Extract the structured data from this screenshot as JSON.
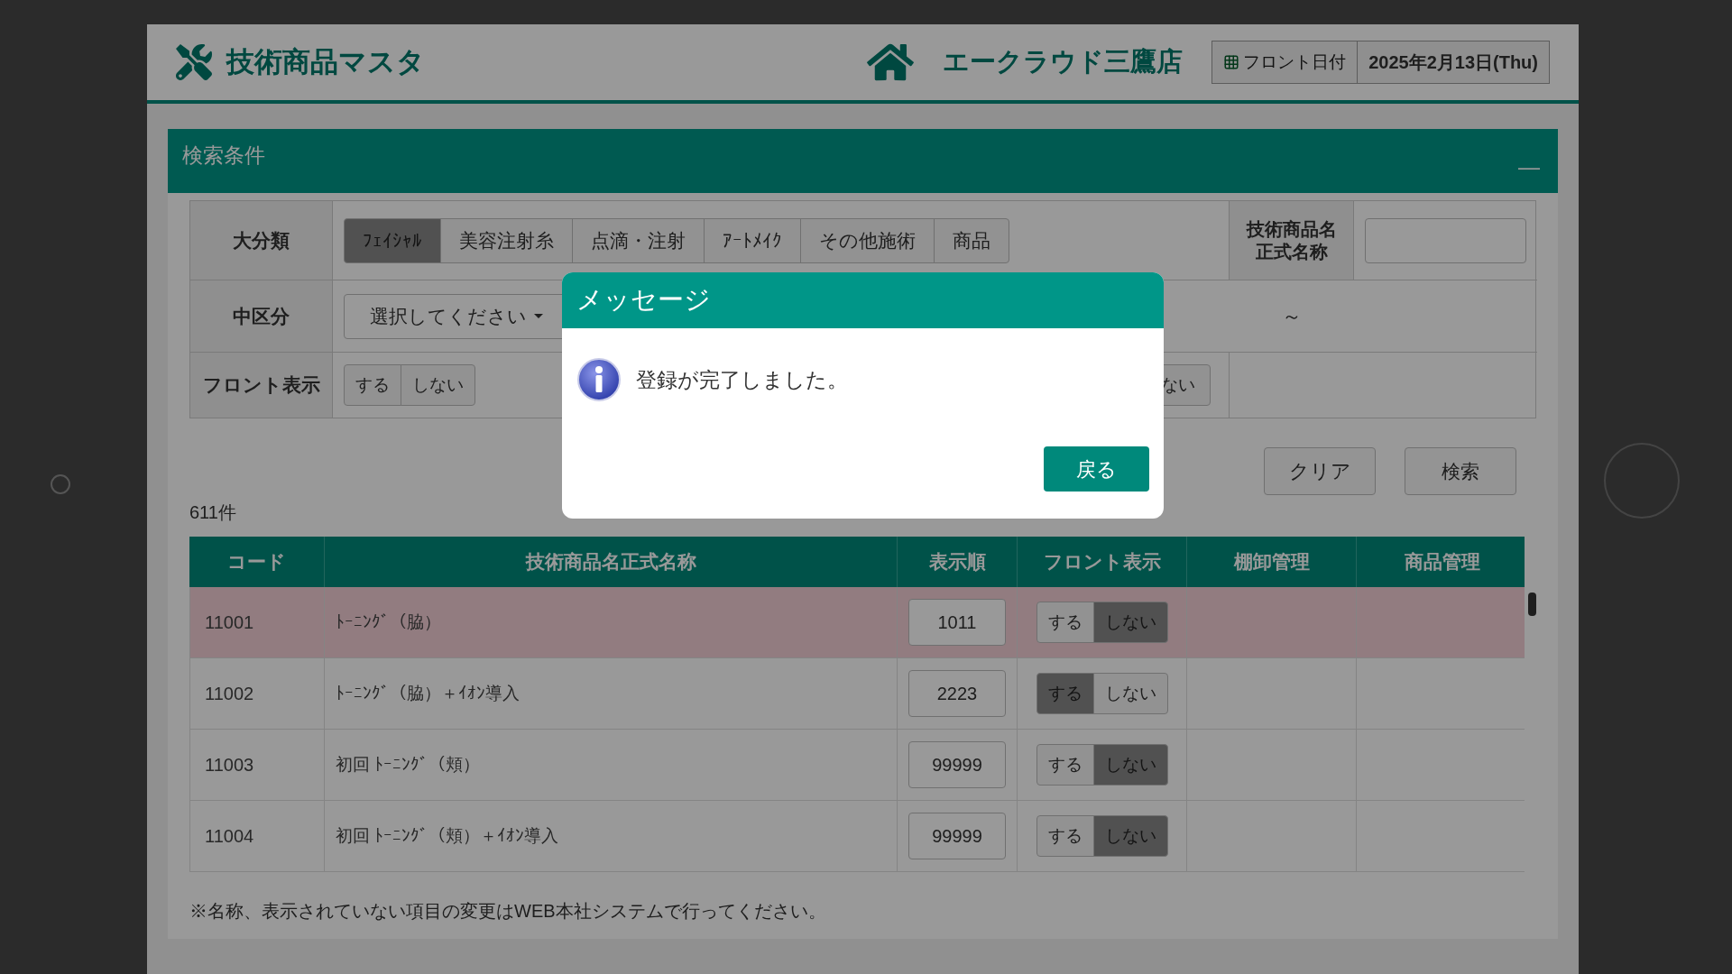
{
  "header": {
    "title": "技術商品マスタ",
    "store": "エークラウド三鷹店",
    "date_label": "フロント日付",
    "date": "2025年2月13日(Thu)"
  },
  "search_panel": {
    "title": "検索条件",
    "collapse": "—",
    "category": {
      "label": "大分類",
      "options": [
        {
          "label": "ﾌｪｲｼｬﾙ",
          "selected": true
        },
        {
          "label": "美容注射糸",
          "selected": false
        },
        {
          "label": "点滴・注射",
          "selected": false
        },
        {
          "label": "ｱｰﾄﾒｲｸ",
          "selected": false
        },
        {
          "label": "その他施術",
          "selected": false
        },
        {
          "label": "商品",
          "selected": false
        }
      ]
    },
    "name_label": [
      "技術商品名",
      "正式名称"
    ],
    "subcategory": {
      "label": "中区分",
      "value": "選択してください"
    },
    "range_separator": "～",
    "front": {
      "label": "フロント表示",
      "options": [
        {
          "label": "する",
          "selected": false
        },
        {
          "label": "しない",
          "selected": false
        }
      ]
    },
    "partial_option": "ない",
    "buttons": [
      "クリア",
      "検索"
    ]
  },
  "count": "611件",
  "table": {
    "columns": [
      "コード",
      "技術商品名正式名称",
      "表示順",
      "フロント表示",
      "棚卸管理",
      "商品管理"
    ],
    "rows": [
      {
        "code": "11001",
        "name": "ﾄｰﾆﾝｸﾞ（脇）",
        "order": "1011",
        "selected": true,
        "front": [
          {
            "label": "する",
            "selected": false
          },
          {
            "label": "しない",
            "selected": true
          }
        ]
      },
      {
        "code": "11002",
        "name": "ﾄｰﾆﾝｸﾞ（脇）＋ｲｵﾝ導入",
        "order": "2223",
        "selected": false,
        "front": [
          {
            "label": "する",
            "selected": true
          },
          {
            "label": "しない",
            "selected": false
          }
        ]
      },
      {
        "code": "11003",
        "name": "初回 ﾄｰﾆﾝｸﾞ（頬）",
        "order": "99999",
        "selected": false,
        "front": [
          {
            "label": "する",
            "selected": false
          },
          {
            "label": "しない",
            "selected": true
          }
        ]
      },
      {
        "code": "11004",
        "name": "初回 ﾄｰﾆﾝｸﾞ（頬）＋ｲｵﾝ導入",
        "order": "99999",
        "selected": false,
        "front": [
          {
            "label": "する",
            "selected": false
          },
          {
            "label": "しない",
            "selected": true
          }
        ]
      }
    ]
  },
  "note": "※名称、表示されていない項目の変更はWEB本社システムで行ってください。",
  "dialog": {
    "title": "メッセージ",
    "message": "登録が完了しました。",
    "button": "戻る"
  }
}
